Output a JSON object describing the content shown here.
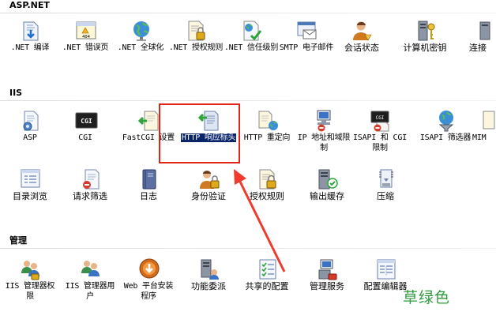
{
  "sections": {
    "aspnet": {
      "title": "ASP.NET",
      "items": [
        {
          "label": ".NET 编译",
          "icon": "compile-icon"
        },
        {
          "label": ".NET 错误页",
          "icon": "error-page-icon"
        },
        {
          "label": ".NET 全球化",
          "icon": "globe-icon"
        },
        {
          "label": ".NET 授权规则",
          "icon": "lock-document-icon"
        },
        {
          "label": ".NET 信任级别",
          "icon": "trust-document-icon"
        },
        {
          "label": "SMTP 电子邮件",
          "icon": "email-icon"
        },
        {
          "label": "会话状态",
          "icon": "session-user-icon"
        },
        {
          "label": "计算机密钥",
          "icon": "machine-key-icon"
        },
        {
          "label": "连接",
          "icon": "connection-icon"
        }
      ]
    },
    "iis": {
      "title": "IIS",
      "items": [
        {
          "label": "ASP",
          "icon": "asp-document-icon"
        },
        {
          "label": "CGI",
          "icon": "cgi-icon"
        },
        {
          "label": "FastCGI 设置",
          "icon": "fastcgi-icon"
        },
        {
          "label": "HTTP 响应标头",
          "icon": "http-headers-icon"
        },
        {
          "label": "HTTP 重定向",
          "icon": "redirect-icon"
        },
        {
          "label": "IP 地址和域限制",
          "icon": "ip-restrict-icon"
        },
        {
          "label": "ISAPI 和 CGI 限制",
          "icon": "isapi-cgi-icon"
        },
        {
          "label": "ISAPI 筛选器",
          "icon": "isapi-filter-icon"
        },
        {
          "label": "MIM",
          "icon": "mime-icon"
        },
        {
          "label": "目录浏览",
          "icon": "directory-browse-icon"
        },
        {
          "label": "请求筛选",
          "icon": "request-filter-icon"
        },
        {
          "label": "日志",
          "icon": "log-book-icon"
        },
        {
          "label": "身份验证",
          "icon": "authentication-icon"
        },
        {
          "label": "授权规则",
          "icon": "authorization-lock-icon"
        },
        {
          "label": "输出缓存",
          "icon": "output-cache-icon"
        },
        {
          "label": "压缩",
          "icon": "compression-icon"
        }
      ]
    },
    "management": {
      "title": "管理",
      "items": [
        {
          "label": "IIS 管理器权限",
          "icon": "manager-permissions-icon"
        },
        {
          "label": "IIS 管理器用户",
          "icon": "manager-users-icon"
        },
        {
          "label": "Web 平台安装程序",
          "icon": "web-platform-installer-icon"
        },
        {
          "label": "功能委派",
          "icon": "feature-delegation-icon"
        },
        {
          "label": "共享的配置",
          "icon": "shared-config-icon"
        },
        {
          "label": "管理服务",
          "icon": "management-service-icon"
        },
        {
          "label": "配置编辑器",
          "icon": "config-editor-icon"
        }
      ]
    }
  },
  "watermark": "草绿色",
  "colors": {
    "highlight_box": "#e2231a",
    "selection_bg": "#0a246a",
    "watermark": "#2e9b3e"
  }
}
